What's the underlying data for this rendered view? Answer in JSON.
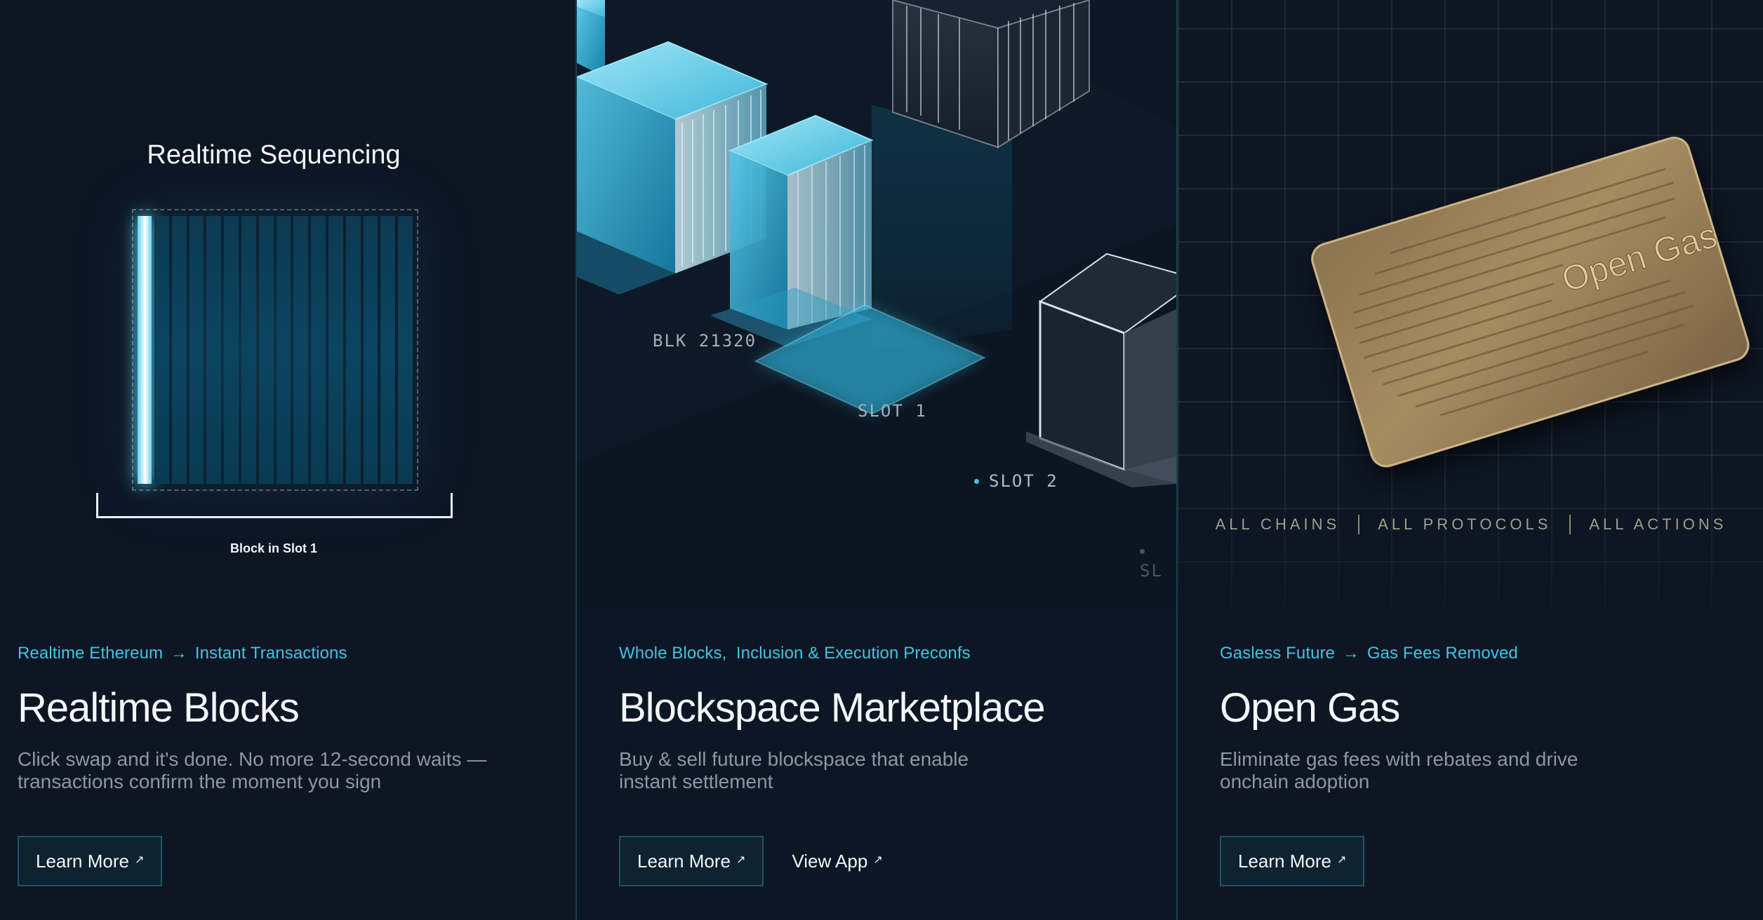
{
  "colors": {
    "accent": "#43c3e2",
    "background": "#0d1623",
    "gold": "#a88c5e"
  },
  "panels": [
    {
      "visual": {
        "heading": "Realtime Sequencing",
        "caption": "Block in Slot 1"
      },
      "tagline": {
        "from": "Realtime Ethereum",
        "to": "Instant Transactions"
      },
      "title": "Realtime Blocks",
      "description": "Click swap and it's done. No more 12-second waits — transactions confirm the moment you sign",
      "actions": [
        {
          "label": "Learn More",
          "icon": "external-arrow-icon",
          "style": "button"
        }
      ]
    },
    {
      "visual": {
        "labels": [
          "BLK 21320",
          "SLOT 1",
          "SLOT 2",
          "SL"
        ]
      },
      "tagline": {
        "text": "Whole Blocks,  Inclusion & Execution Preconfs"
      },
      "title": "Blockspace Marketplace",
      "description": "Buy & sell future blockspace that enable instant settlement",
      "actions": [
        {
          "label": "Learn More",
          "icon": "external-arrow-icon",
          "style": "button"
        },
        {
          "label": "View App",
          "icon": "external-arrow-icon",
          "style": "link"
        }
      ]
    },
    {
      "visual": {
        "card_text": "Open Gas",
        "scope": [
          "ALL CHAINS",
          "ALL PROTOCOLS",
          "ALL ACTIONS"
        ]
      },
      "tagline": {
        "from": "Gasless Future",
        "to": "Gas Fees Removed"
      },
      "title": "Open Gas",
      "description": "Eliminate gas fees with rebates and drive onchain adoption",
      "actions": [
        {
          "label": "Learn More",
          "icon": "external-arrow-icon",
          "style": "button"
        }
      ]
    }
  ],
  "glyphs": {
    "arrow": "→",
    "external": "↗"
  }
}
